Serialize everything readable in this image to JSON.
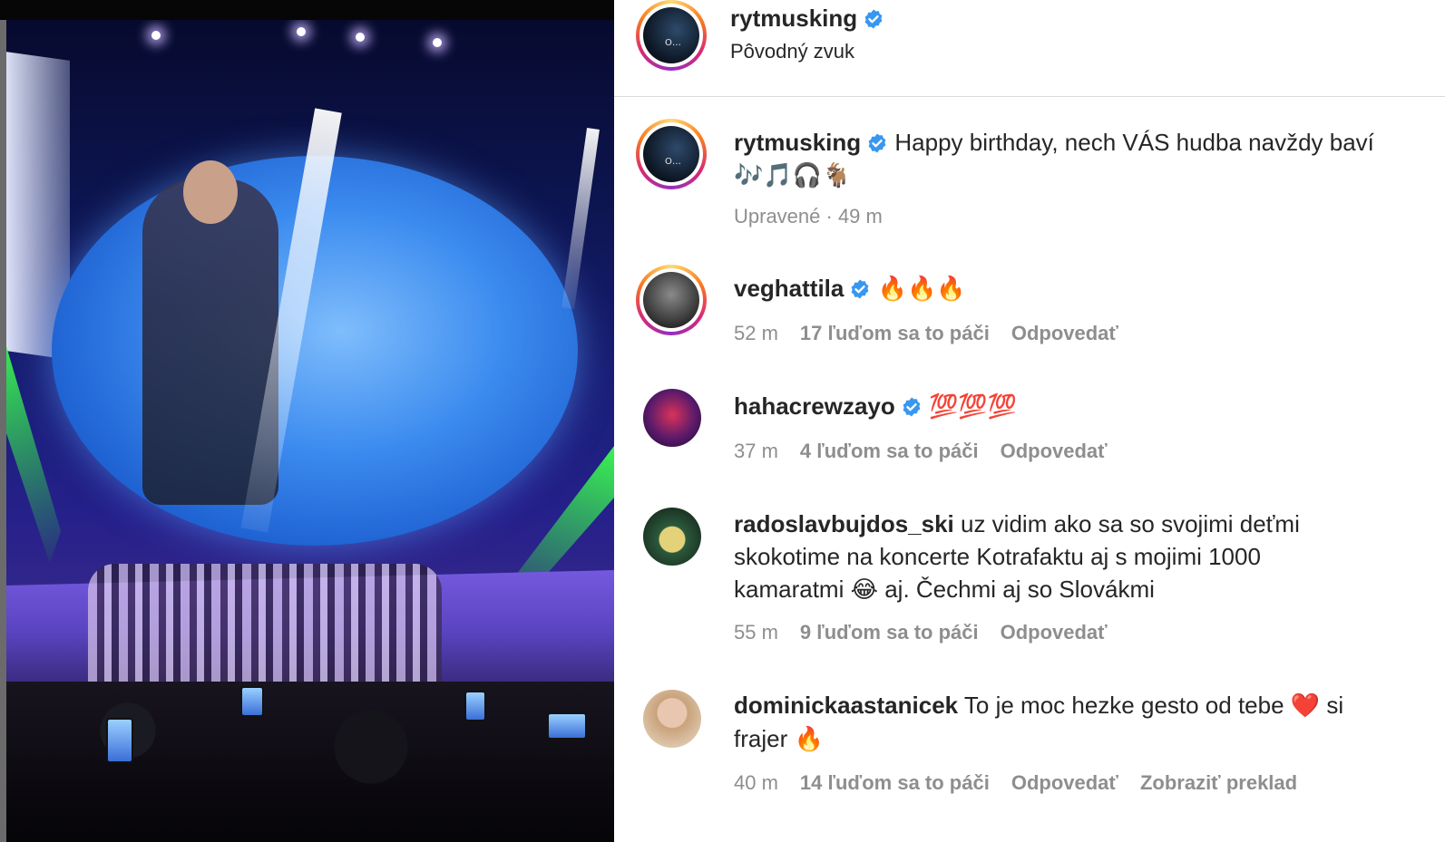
{
  "header": {
    "username": "rytmusking",
    "subtitle": "Pôvodný zvuk"
  },
  "caption": {
    "username": "rytmusking",
    "text": "Happy birthday, nech VÁS hudba navždy baví",
    "emoji_line": "🎶🎵🎧🐐",
    "meta": "Upravené · 49 m"
  },
  "comments": [
    {
      "username": "veghattila",
      "verified": true,
      "text": "🔥🔥🔥",
      "time": "52 m",
      "likes": "17 ľuďom sa to páči",
      "reply": "Odpovedať"
    },
    {
      "username": "hahacrewzayo",
      "verified": true,
      "text": "💯💯💯",
      "time": "37 m",
      "likes": "4 ľuďom sa to páči",
      "reply": "Odpovedať"
    },
    {
      "username": "radoslavbujdos_ski",
      "verified": false,
      "text_line1": "uz vidim ako sa so svojimi deťmi",
      "text_line2": "skokotime na koncerte Kotrafaktu aj s mojimi 1000",
      "text_line3_a": "kamaratmi",
      "text_line3_emoji": "😂",
      "text_line3_b": "aj. Čechmi aj so Slovákmi",
      "time": "55 m",
      "likes": "9 ľuďom sa to páči",
      "reply": "Odpovedať"
    },
    {
      "username": "dominickaastanicek",
      "verified": false,
      "text_a": "To je moc hezke gesto od tebe",
      "text_heart": "❤️",
      "text_b": "si",
      "text_line2": "frajer",
      "text_line2_emoji": "🔥",
      "time": "40 m",
      "likes": "14 ľuďom sa to páči",
      "reply": "Odpovedať",
      "translate": "Zobraziť preklad"
    }
  ],
  "colors": {
    "verified_blue": "#3897f0",
    "meta_gray": "#8e8e8e",
    "text_dark": "#262626"
  },
  "icons": [
    "verified-badge-icon"
  ]
}
